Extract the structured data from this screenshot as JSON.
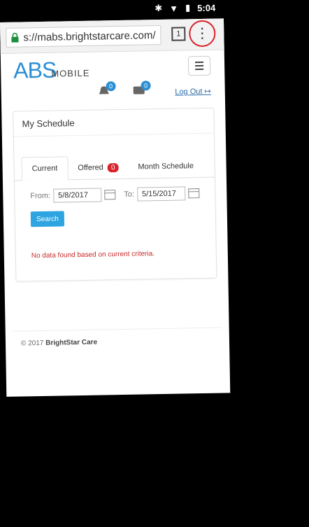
{
  "status": {
    "time": "5:04"
  },
  "browser": {
    "url": "s://mabs.brightstarcare.com/",
    "tab_count": "1"
  },
  "header": {
    "logo_main": "ABS",
    "logo_sub": "MOBILE",
    "logout_label": "Log Out"
  },
  "notifications": [
    {
      "count": "0"
    },
    {
      "count": "0"
    }
  ],
  "panel": {
    "title": "My Schedule",
    "tabs": [
      {
        "label": "Current"
      },
      {
        "label": "Offered",
        "badge": "0"
      },
      {
        "label": "Month Schedule"
      }
    ],
    "filters": {
      "from_label": "From:",
      "from_value": "5/8/2017",
      "to_label": "To:",
      "to_value": "5/15/2017",
      "search_label": "Search"
    },
    "empty_message": "No data found based on current criteria."
  },
  "footer": {
    "copyright": "© 2017",
    "company": "BrightStar Care"
  },
  "colors": {
    "accent": "#2b8fd4",
    "danger": "#d9232d",
    "button": "#2ea4e0"
  }
}
